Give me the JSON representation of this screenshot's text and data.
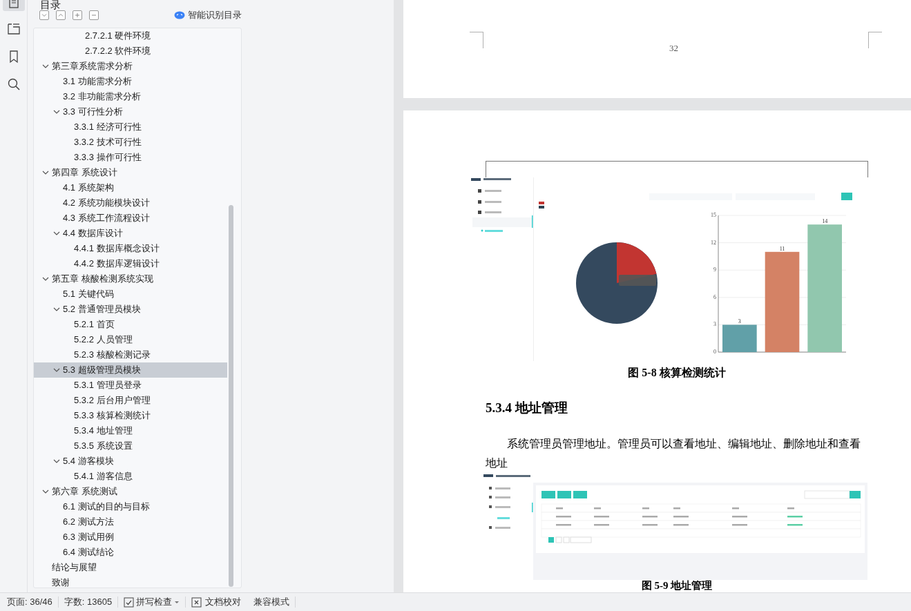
{
  "sidebar_header": {
    "title": "目录",
    "smart_toc": "智能识别目录"
  },
  "rail": [
    {
      "kind": "page",
      "selected": true
    },
    {
      "kind": "outline",
      "selected": false
    },
    {
      "kind": "bookmark",
      "selected": false
    },
    {
      "kind": "search",
      "selected": false
    }
  ],
  "toc": {
    "continued": [
      {
        "label": "2.7.2.1  硬件环境",
        "selected": false
      },
      {
        "label": "2.7.2.2  软件环境",
        "selected": false
      }
    ],
    "items": [
      {
        "label": "第三章系统需求分析",
        "selected": false,
        "expanded": true,
        "children": [
          {
            "label": "3.1  功能需求分析",
            "selected": false
          },
          {
            "label": "3.2  非功能需求分析",
            "selected": false
          },
          {
            "label": "3.3  可行性分析",
            "selected": false,
            "expanded": true,
            "children": [
              {
                "label": "3.3.1  经济可行性",
                "selected": false
              },
              {
                "label": "3.3.2  技术可行性",
                "selected": false
              },
              {
                "label": "3.3.3  操作可行性",
                "selected": false
              }
            ]
          }
        ]
      },
      {
        "label": "第四章  系统设计",
        "selected": false,
        "expanded": true,
        "children": [
          {
            "label": "4.1  系统架构",
            "selected": false
          },
          {
            "label": "4.2  系统功能模块设计",
            "selected": false
          },
          {
            "label": "4.3  系统工作流程设计",
            "selected": false
          },
          {
            "label": "4.4  数据库设计",
            "selected": false,
            "expanded": true,
            "children": [
              {
                "label": "4.4.1  数据库概念设计",
                "selected": false
              },
              {
                "label": "4.4.2  数据库逻辑设计",
                "selected": false
              }
            ]
          }
        ]
      },
      {
        "label": "第五章  核酸检测系统实现",
        "selected": false,
        "expanded": true,
        "children": [
          {
            "label": "5.1  关键代码",
            "selected": false
          },
          {
            "label": "5.2  普通管理员模块",
            "selected": false,
            "expanded": true,
            "children": [
              {
                "label": "5.2.1  首页",
                "selected": false
              },
              {
                "label": "5.2.2 人员管理",
                "selected": false
              },
              {
                "label": "5.2.3  核酸检测记录",
                "selected": false
              }
            ]
          },
          {
            "label": "5.3  超级管理员模块",
            "selected": true,
            "expanded": true,
            "children": [
              {
                "label": "5.3.1  管理员登录",
                "selected": false
              },
              {
                "label": "5.3.2 后台用户管理",
                "selected": false
              },
              {
                "label": "5.3.3  核算检测统计",
                "selected": false
              },
              {
                "label": "5.3.4  地址管理",
                "selected": false
              },
              {
                "label": "5.3.5  系统设置",
                "selected": false
              }
            ]
          },
          {
            "label": "5.4  游客模块",
            "selected": false,
            "expanded": true,
            "children": [
              {
                "label": "5.4.1  游客信息",
                "selected": false
              }
            ]
          }
        ]
      },
      {
        "label": "第六章  系统测试",
        "selected": false,
        "expanded": true,
        "children": [
          {
            "label": "6.1  测试的目的与目标",
            "selected": false
          },
          {
            "label": "6.2  测试方法",
            "selected": false
          },
          {
            "label": "6.3  测试用例",
            "selected": false
          },
          {
            "label": "6.4  测试结论",
            "selected": false
          }
        ]
      },
      {
        "label": "结论与展望",
        "selected": false
      },
      {
        "label": "致谢",
        "selected": false
      }
    ]
  },
  "document": {
    "page_number": "32",
    "figure_1": {
      "chart_data": {
        "type": "bar",
        "ylim": [
          0,
          15
        ],
        "yticks": [
          0,
          3,
          6,
          9,
          12,
          15
        ],
        "data_labels": true,
        "grid": true,
        "series": [
          {
            "values": [
              3,
              11,
              14
            ],
            "colors": [
              "#61a0a8",
              "#d48265",
              "#91c7ae"
            ]
          }
        ]
      }
    },
    "figure_1_caption": "图 5-8  核算检测统计",
    "heading": "5.3.4  地址管理",
    "paragraph": "系统管理员管理地址。管理员可以查看地址、编辑地址、删除地址和查看地址",
    "figure_2_caption": "图 5-9  地址管理"
  },
  "status_bar": {
    "page": "页面: 36/46",
    "words": "字数: 13605",
    "spell_check": "拼写检查",
    "proofread": "文档校对",
    "mode": "兼容模式"
  }
}
